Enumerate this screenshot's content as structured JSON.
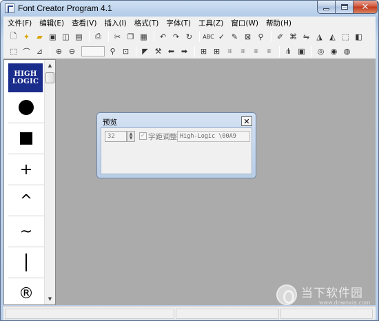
{
  "window": {
    "title": "Font Creator Program 4.1"
  },
  "menubar": {
    "items": [
      "文件(F)",
      "编辑(E)",
      "查看(V)",
      "插入(I)",
      "格式(T)",
      "字体(T)",
      "工具(Z)",
      "窗口(W)",
      "帮助(H)"
    ]
  },
  "toolbar1": {
    "icons": [
      "new-icon",
      "open-star-icon",
      "open-folder-icon",
      "save-icon",
      "save-all-icon",
      "close-doc-icon",
      "print-icon",
      "cut-icon",
      "copy-icon",
      "paste-icon",
      "undo-icon",
      "redo-icon",
      "refresh-icon",
      "abc-icon",
      "spell-icon",
      "paint-icon",
      "preview-icon",
      "search-icon",
      "pen-icon",
      "node-icon",
      "flip-icon",
      "triangle-left-icon",
      "triangle-right-icon",
      "shape-a-icon",
      "shape-b-icon"
    ]
  },
  "toolbar2": {
    "icons": [
      "select-rect-icon",
      "lasso-icon",
      "measure-icon",
      "zoom-in-icon",
      "zoom-out-icon",
      "zoom-icon",
      "zoom-fit-icon",
      "pointer-icon",
      "tool-icon",
      "arrow-left-icon",
      "arrow-right-icon",
      "grid-a-icon",
      "grid-b-icon",
      "crop-a-icon",
      "crop-b-icon",
      "crop-c-icon",
      "crop-d-icon",
      "tree-icon",
      "frame-icon",
      "circle-a-icon",
      "circle-b-icon",
      "circle-c-icon"
    ]
  },
  "glyph_panel": {
    "logo_line1": "HIGH",
    "logo_line2": "LOGIC",
    "glyphs": [
      "●",
      "■",
      "+",
      "^",
      "~",
      "|",
      "®"
    ]
  },
  "preview": {
    "title": "预览",
    "close_label": "✕",
    "size_value": "32",
    "kerning_label": "字距调整",
    "kerning_checked": true,
    "text_value": "High-Logic \\00A9"
  },
  "watermark": {
    "text": "当下软件园",
    "url": "www.downxia.com"
  },
  "colors": {
    "workspace": "#ababab",
    "logo_bg": "#1a2c8c",
    "close_button": "#c3391c"
  }
}
